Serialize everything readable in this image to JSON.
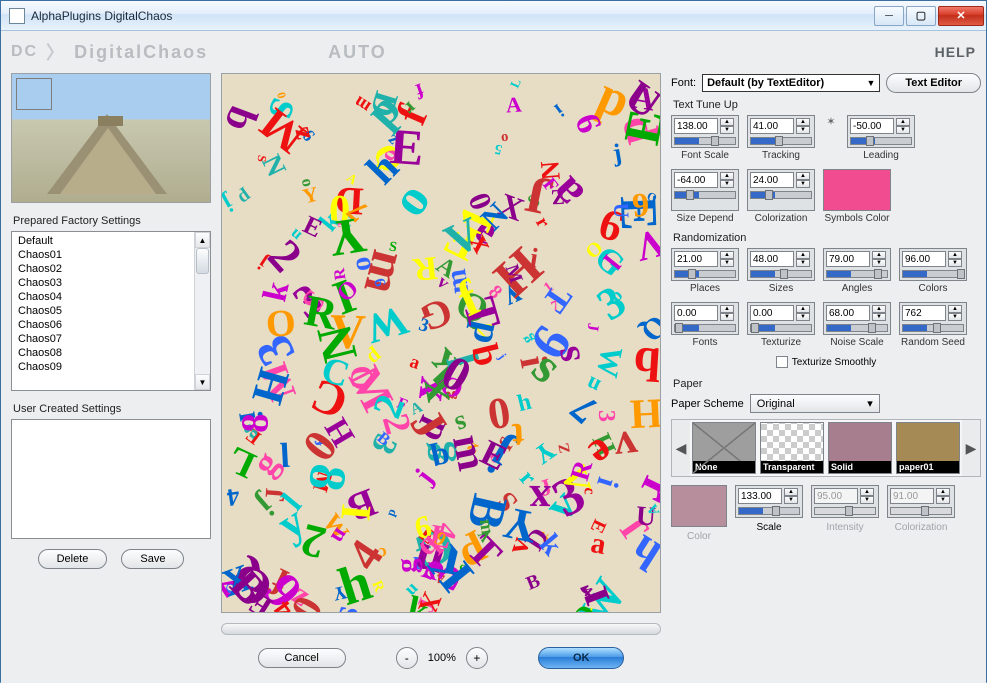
{
  "window": {
    "title": "AlphaPlugins DigitalChaos"
  },
  "brand": {
    "dc": "DC",
    "name": "DigitalChaos",
    "auto": "AUTO",
    "help": "HELP"
  },
  "left": {
    "factory_label": "Prepared Factory Settings",
    "presets": [
      "Default",
      "Chaos01",
      "Chaos02",
      "Chaos03",
      "Chaos04",
      "Chaos05",
      "Chaos06",
      "Chaos07",
      "Chaos08",
      "Chaos09"
    ],
    "user_label": "User Created Settings",
    "delete": "Delete",
    "save": "Save"
  },
  "mid": {
    "cancel": "Cancel",
    "zoom": "100%",
    "ok": "OK"
  },
  "right": {
    "font_label": "Font:",
    "font_value": "Default (by TextEditor)",
    "text_editor": "Text Editor",
    "tuneup": "Text Tune Up",
    "tune": {
      "font_scale": {
        "v": "138.00",
        "l": "Font Scale"
      },
      "tracking": {
        "v": "41.00",
        "l": "Tracking"
      },
      "leading": {
        "v": "-50.00",
        "l": "Leading"
      },
      "size_dep": {
        "v": "-64.00",
        "l": "Size Depend"
      },
      "coloriz": {
        "v": "24.00",
        "l": "Colorization"
      },
      "symcolor": {
        "l": "Symbols Color",
        "hex": "#f04c8f"
      }
    },
    "rand_title": "Randomization",
    "rand": {
      "places": {
        "v": "21.00",
        "l": "Places"
      },
      "sizes": {
        "v": "48.00",
        "l": "Sizes"
      },
      "angles": {
        "v": "79.00",
        "l": "Angles"
      },
      "colors": {
        "v": "96.00",
        "l": "Colors"
      },
      "fonts": {
        "v": "0.00",
        "l": "Fonts"
      },
      "texturize": {
        "v": "0.00",
        "l": "Texturize"
      },
      "noise": {
        "v": "68.00",
        "l": "Noise Scale"
      },
      "seed": {
        "v": "762",
        "l": "Random Seed"
      }
    },
    "tex_smooth": "Texturize Smoothly",
    "paper_title": "Paper",
    "paper_scheme_lbl": "Paper Scheme",
    "paper_scheme_val": "Original",
    "paper_thumbs": [
      "None",
      "Transparent",
      "Solid",
      "paper01"
    ],
    "paper_params": {
      "color": {
        "l": "Color",
        "hex": "#b78f9c"
      },
      "scale": {
        "v": "133.00",
        "l": "Scale"
      },
      "intensity": {
        "v": "95.00",
        "l": "Intensity"
      },
      "colorization": {
        "v": "91.00",
        "l": "Colorization"
      }
    }
  }
}
